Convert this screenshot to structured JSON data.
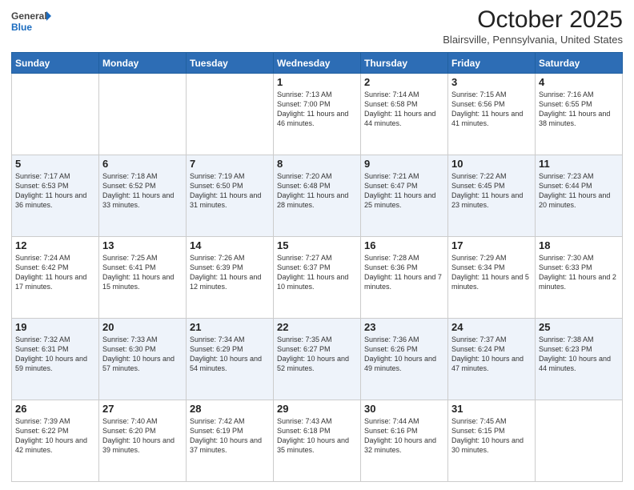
{
  "header": {
    "logo_line1": "General",
    "logo_line2": "Blue",
    "month": "October 2025",
    "location": "Blairsville, Pennsylvania, United States"
  },
  "days_of_week": [
    "Sunday",
    "Monday",
    "Tuesday",
    "Wednesday",
    "Thursday",
    "Friday",
    "Saturday"
  ],
  "weeks": [
    [
      {
        "day": "",
        "info": ""
      },
      {
        "day": "",
        "info": ""
      },
      {
        "day": "",
        "info": ""
      },
      {
        "day": "1",
        "info": "Sunrise: 7:13 AM\nSunset: 7:00 PM\nDaylight: 11 hours\nand 46 minutes."
      },
      {
        "day": "2",
        "info": "Sunrise: 7:14 AM\nSunset: 6:58 PM\nDaylight: 11 hours\nand 44 minutes."
      },
      {
        "day": "3",
        "info": "Sunrise: 7:15 AM\nSunset: 6:56 PM\nDaylight: 11 hours\nand 41 minutes."
      },
      {
        "day": "4",
        "info": "Sunrise: 7:16 AM\nSunset: 6:55 PM\nDaylight: 11 hours\nand 38 minutes."
      }
    ],
    [
      {
        "day": "5",
        "info": "Sunrise: 7:17 AM\nSunset: 6:53 PM\nDaylight: 11 hours\nand 36 minutes."
      },
      {
        "day": "6",
        "info": "Sunrise: 7:18 AM\nSunset: 6:52 PM\nDaylight: 11 hours\nand 33 minutes."
      },
      {
        "day": "7",
        "info": "Sunrise: 7:19 AM\nSunset: 6:50 PM\nDaylight: 11 hours\nand 31 minutes."
      },
      {
        "day": "8",
        "info": "Sunrise: 7:20 AM\nSunset: 6:48 PM\nDaylight: 11 hours\nand 28 minutes."
      },
      {
        "day": "9",
        "info": "Sunrise: 7:21 AM\nSunset: 6:47 PM\nDaylight: 11 hours\nand 25 minutes."
      },
      {
        "day": "10",
        "info": "Sunrise: 7:22 AM\nSunset: 6:45 PM\nDaylight: 11 hours\nand 23 minutes."
      },
      {
        "day": "11",
        "info": "Sunrise: 7:23 AM\nSunset: 6:44 PM\nDaylight: 11 hours\nand 20 minutes."
      }
    ],
    [
      {
        "day": "12",
        "info": "Sunrise: 7:24 AM\nSunset: 6:42 PM\nDaylight: 11 hours\nand 17 minutes."
      },
      {
        "day": "13",
        "info": "Sunrise: 7:25 AM\nSunset: 6:41 PM\nDaylight: 11 hours\nand 15 minutes."
      },
      {
        "day": "14",
        "info": "Sunrise: 7:26 AM\nSunset: 6:39 PM\nDaylight: 11 hours\nand 12 minutes."
      },
      {
        "day": "15",
        "info": "Sunrise: 7:27 AM\nSunset: 6:37 PM\nDaylight: 11 hours\nand 10 minutes."
      },
      {
        "day": "16",
        "info": "Sunrise: 7:28 AM\nSunset: 6:36 PM\nDaylight: 11 hours\nand 7 minutes."
      },
      {
        "day": "17",
        "info": "Sunrise: 7:29 AM\nSunset: 6:34 PM\nDaylight: 11 hours\nand 5 minutes."
      },
      {
        "day": "18",
        "info": "Sunrise: 7:30 AM\nSunset: 6:33 PM\nDaylight: 11 hours\nand 2 minutes."
      }
    ],
    [
      {
        "day": "19",
        "info": "Sunrise: 7:32 AM\nSunset: 6:31 PM\nDaylight: 10 hours\nand 59 minutes."
      },
      {
        "day": "20",
        "info": "Sunrise: 7:33 AM\nSunset: 6:30 PM\nDaylight: 10 hours\nand 57 minutes."
      },
      {
        "day": "21",
        "info": "Sunrise: 7:34 AM\nSunset: 6:29 PM\nDaylight: 10 hours\nand 54 minutes."
      },
      {
        "day": "22",
        "info": "Sunrise: 7:35 AM\nSunset: 6:27 PM\nDaylight: 10 hours\nand 52 minutes."
      },
      {
        "day": "23",
        "info": "Sunrise: 7:36 AM\nSunset: 6:26 PM\nDaylight: 10 hours\nand 49 minutes."
      },
      {
        "day": "24",
        "info": "Sunrise: 7:37 AM\nSunset: 6:24 PM\nDaylight: 10 hours\nand 47 minutes."
      },
      {
        "day": "25",
        "info": "Sunrise: 7:38 AM\nSunset: 6:23 PM\nDaylight: 10 hours\nand 44 minutes."
      }
    ],
    [
      {
        "day": "26",
        "info": "Sunrise: 7:39 AM\nSunset: 6:22 PM\nDaylight: 10 hours\nand 42 minutes."
      },
      {
        "day": "27",
        "info": "Sunrise: 7:40 AM\nSunset: 6:20 PM\nDaylight: 10 hours\nand 39 minutes."
      },
      {
        "day": "28",
        "info": "Sunrise: 7:42 AM\nSunset: 6:19 PM\nDaylight: 10 hours\nand 37 minutes."
      },
      {
        "day": "29",
        "info": "Sunrise: 7:43 AM\nSunset: 6:18 PM\nDaylight: 10 hours\nand 35 minutes."
      },
      {
        "day": "30",
        "info": "Sunrise: 7:44 AM\nSunset: 6:16 PM\nDaylight: 10 hours\nand 32 minutes."
      },
      {
        "day": "31",
        "info": "Sunrise: 7:45 AM\nSunset: 6:15 PM\nDaylight: 10 hours\nand 30 minutes."
      },
      {
        "day": "",
        "info": ""
      }
    ]
  ]
}
